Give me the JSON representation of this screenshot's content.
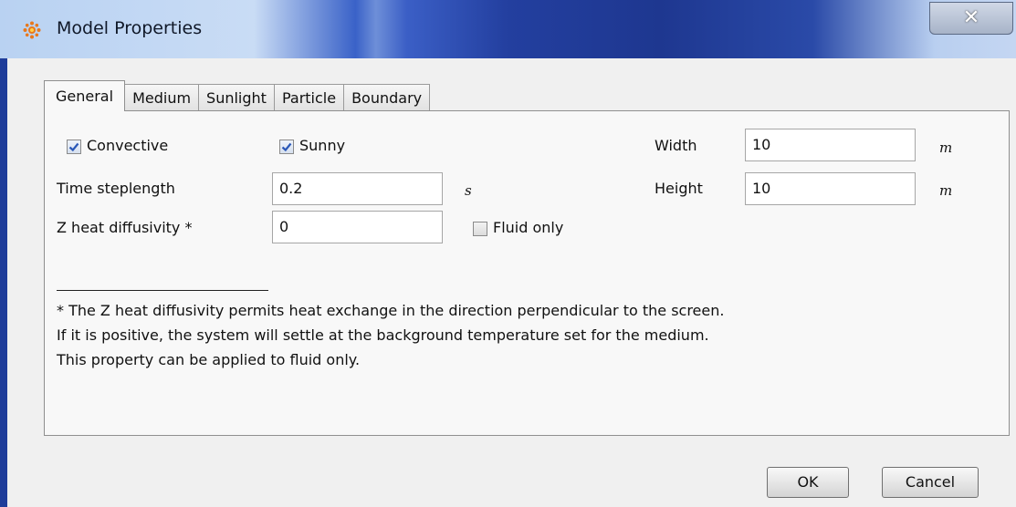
{
  "window": {
    "title": "Model Properties",
    "close_glyph": "✕",
    "accent_title_color": "#233f9f"
  },
  "tabs": [
    {
      "label": "General",
      "active": true
    },
    {
      "label": "Medium",
      "active": false
    },
    {
      "label": "Sunlight",
      "active": false
    },
    {
      "label": "Particle",
      "active": false
    },
    {
      "label": "Boundary",
      "active": false
    }
  ],
  "general": {
    "convective": {
      "label": "Convective",
      "checked": true
    },
    "sunny": {
      "label": "Sunny",
      "checked": true
    },
    "time_steplength": {
      "label": "Time steplength",
      "value": "0.2",
      "unit": "s"
    },
    "z_heat_diffusivity": {
      "label": "Z heat diffusivity *",
      "value": "0"
    },
    "fluid_only": {
      "label": "Fluid only",
      "checked": false
    },
    "width": {
      "label": "Width",
      "value": "10",
      "unit": "m"
    },
    "height": {
      "label": "Height",
      "value": "10",
      "unit": "m"
    },
    "footnote": [
      "* The Z heat diffusivity permits heat exchange in the direction perpendicular to the screen.",
      "If it is positive, the system will settle at the background temperature set for the medium.",
      "This property can be applied to fluid only."
    ]
  },
  "buttons": {
    "ok": "OK",
    "cancel": "Cancel"
  },
  "icons": {
    "app_icon": "sun-icon",
    "close_icon": "close-icon",
    "check_icon": "checkmark-icon"
  }
}
